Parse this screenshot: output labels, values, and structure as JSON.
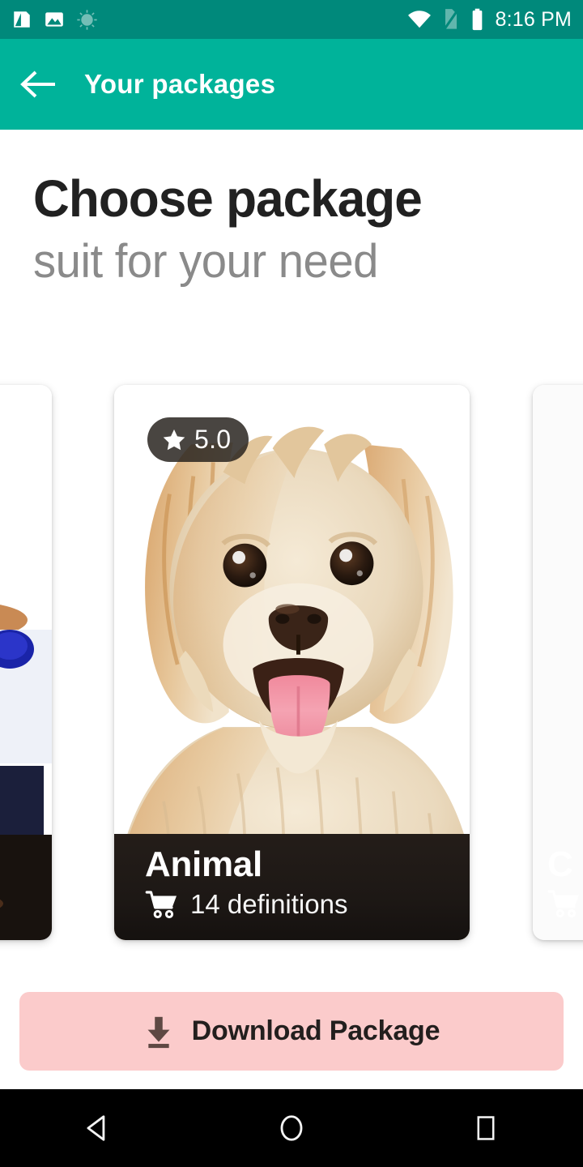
{
  "statusbar": {
    "time": "8:16 PM",
    "left_icons": [
      "screenshot-icon",
      "image-icon",
      "sun-brightness-icon"
    ],
    "right_icons": [
      "wifi-icon",
      "no-sim-icon",
      "battery-full-icon"
    ],
    "bg_color": "#00897B"
  },
  "appbar": {
    "back_icon": "arrow-left-icon",
    "title": "Your packages",
    "bg_color": "#00B39A",
    "text_color": "#FFFFFF"
  },
  "headings": {
    "primary": "Choose package",
    "secondary": "suit for your need",
    "primary_color": "#212121",
    "secondary_color": "#8A8A8A"
  },
  "carousel": {
    "cards": [
      {
        "id": "prev-card",
        "title": "",
        "definitions_label": "",
        "rating": "",
        "image_name": "food-bowl-photo",
        "position": "partial-left"
      },
      {
        "id": "animal-card",
        "title": "Animal",
        "definitions_label": "14 definitions",
        "rating": "5.0",
        "star_icon": "star-icon",
        "cart_icon": "shopping-cart-icon",
        "image_name": "golden-puppy-photo",
        "position": "center-active"
      },
      {
        "id": "next-card",
        "title": "C",
        "definitions_label": "",
        "rating": "",
        "cart_icon": "shopping-cart-icon",
        "image_name": "country-flags-photo",
        "position": "partial-right"
      }
    ]
  },
  "download_button": {
    "label": "Download Package",
    "icon": "download-icon",
    "bg_color": "#FBCBCB",
    "text_color": "#231F1E"
  },
  "navbar": {
    "back_label": "back-triangle",
    "home_label": "home-circle",
    "recents_label": "recents-square",
    "bg_color": "#000000"
  }
}
